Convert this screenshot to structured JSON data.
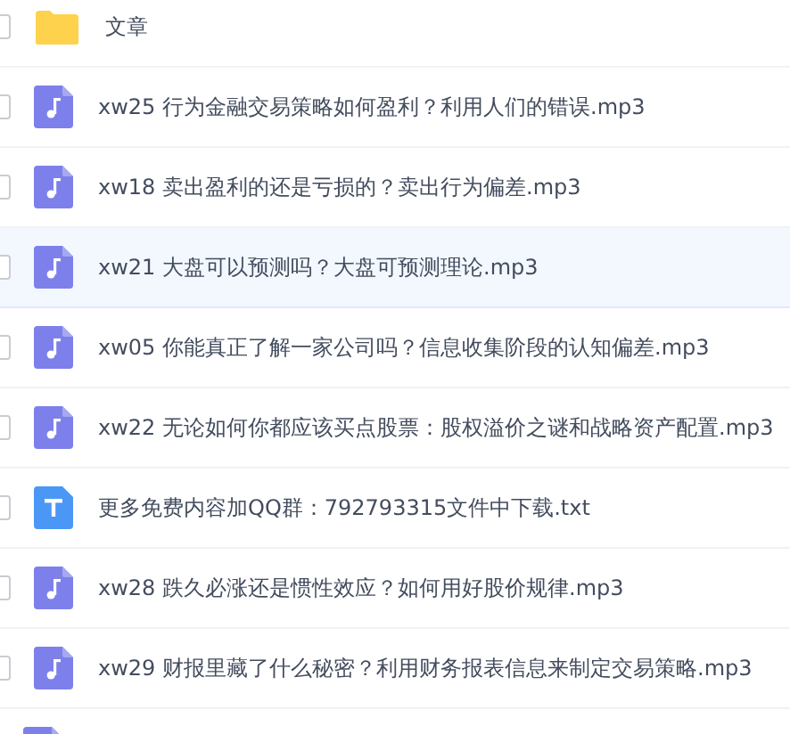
{
  "files": [
    {
      "kind": "folder",
      "name": "文章",
      "selected": false
    },
    {
      "kind": "audio",
      "name": "xw25 行为金融交易策略如何盈利？利用人们的错误.mp3",
      "selected": false
    },
    {
      "kind": "audio",
      "name": "xw18 卖出盈利的还是亏损的？卖出行为偏差.mp3",
      "selected": false
    },
    {
      "kind": "audio",
      "name": "xw21 大盘可以预测吗？大盘可预测理论.mp3",
      "selected": true
    },
    {
      "kind": "audio",
      "name": "xw05 你能真正了解一家公司吗？信息收集阶段的认知偏差.mp3",
      "selected": false
    },
    {
      "kind": "audio",
      "name": "xw22 无论如何你都应该买点股票：股权溢价之谜和战略资产配置.mp3",
      "selected": false
    },
    {
      "kind": "text",
      "name": "更多免费内容加QQ群：792793315文件中下载.txt",
      "selected": false
    },
    {
      "kind": "audio",
      "name": "xw28 跌久必涨还是惯性效应？如何用好股价规律.mp3",
      "selected": false
    },
    {
      "kind": "audio",
      "name": "xw29 财报里藏了什么秘密？利用财务报表信息来制定交易策略.mp3",
      "selected": false
    },
    {
      "kind": "audio",
      "selected": false
    }
  ]
}
